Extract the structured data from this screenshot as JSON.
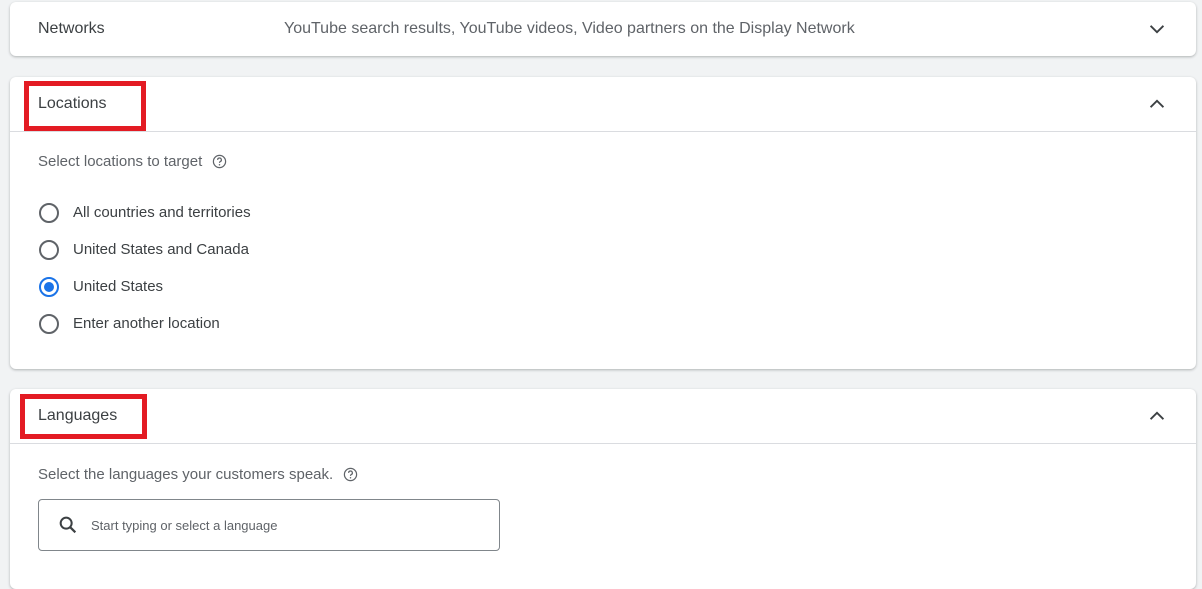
{
  "networks": {
    "title": "Networks",
    "summary": "YouTube search results, YouTube videos, Video partners on the Display Network",
    "expanded": false
  },
  "locations": {
    "title": "Locations",
    "expanded": true,
    "prompt": "Select locations to target",
    "options": [
      {
        "label": "All countries and territories",
        "selected": false
      },
      {
        "label": "United States and Canada",
        "selected": false
      },
      {
        "label": "United States",
        "selected": true
      },
      {
        "label": "Enter another location",
        "selected": false
      }
    ]
  },
  "languages": {
    "title": "Languages",
    "expanded": true,
    "prompt": "Select the languages your customers speak.",
    "search": {
      "value": "",
      "placeholder": "Start typing or select a language"
    }
  },
  "colors": {
    "accent": "#1a73e8",
    "highlight": "#e31b23"
  }
}
